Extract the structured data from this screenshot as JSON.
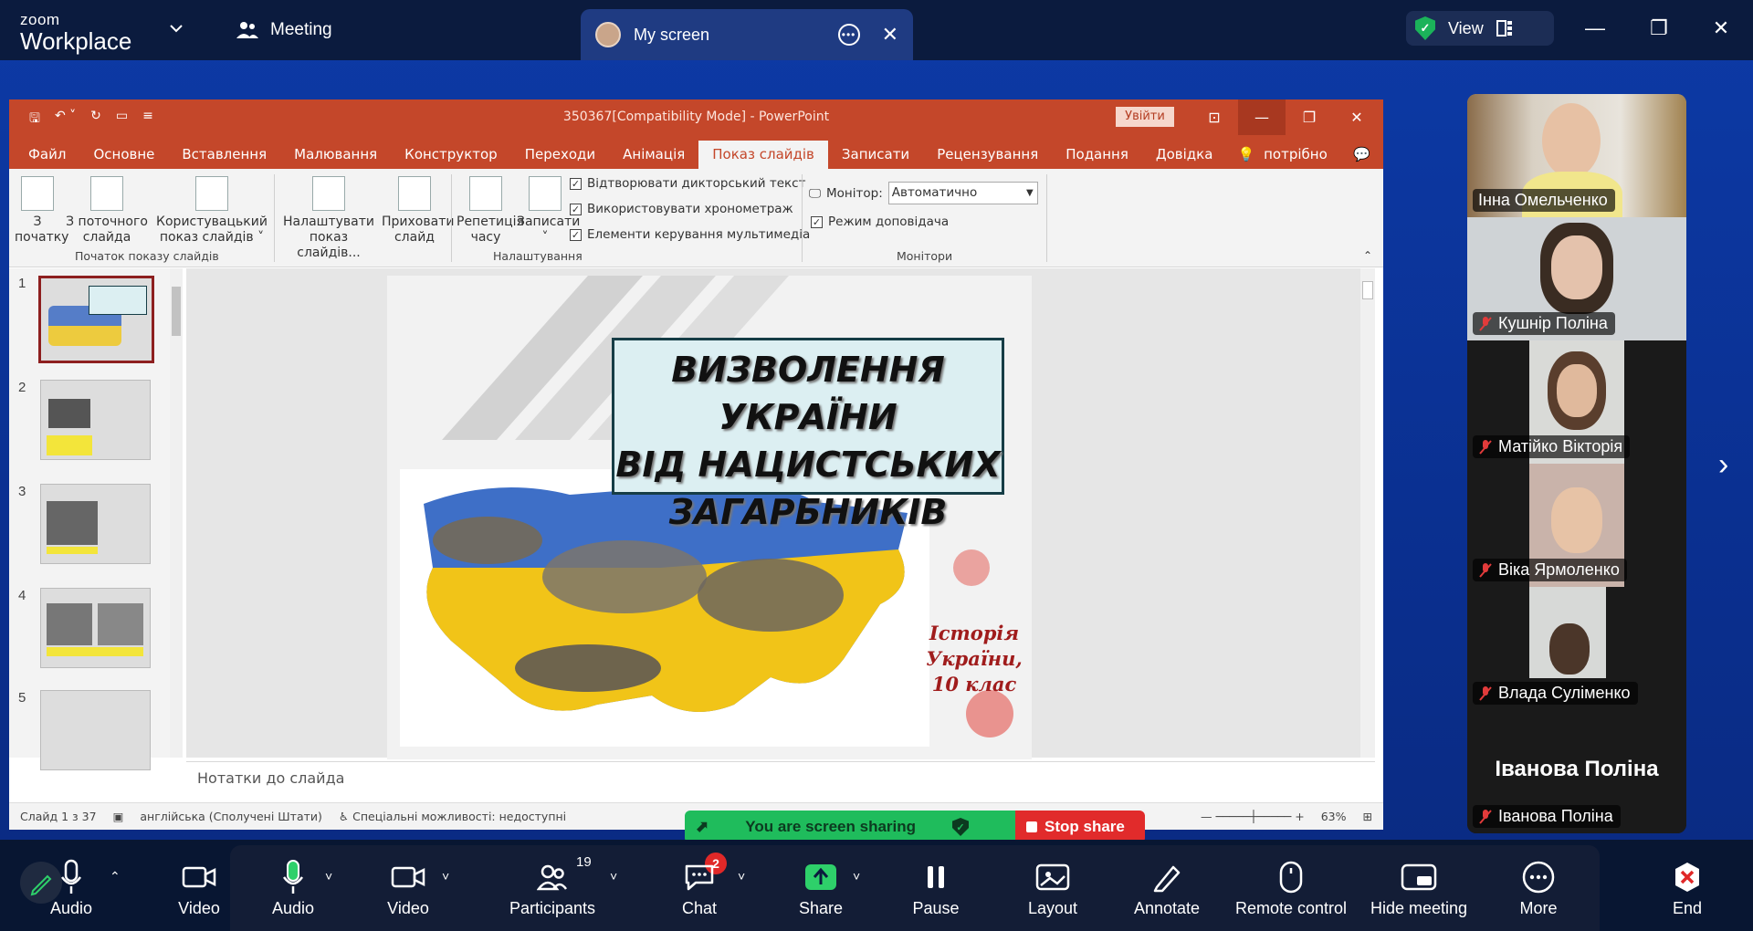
{
  "zoom": {
    "logo_top": "zoom",
    "logo_bottom": "Workplace",
    "meeting_tab": "Meeting",
    "share_tab": "My screen",
    "view_label": "View"
  },
  "ppt": {
    "title": "350367[Compatibility Mode]  -  PowerPoint",
    "signin": "Увійти",
    "tabs": [
      "Файл",
      "Основне",
      "Вставлення",
      "Малювання",
      "Конструктор",
      "Переходи",
      "Анімація",
      "Показ слайдів",
      "Записати",
      "Рецензування",
      "Подання",
      "Довідка"
    ],
    "tell_me": "Скажіть, що потрібно зробити",
    "ribbon": {
      "from_start": [
        "З",
        "початку"
      ],
      "from_current": [
        "З поточного",
        "слайда"
      ],
      "custom": [
        "Користувацький",
        "показ слайдів ˅"
      ],
      "group1": "Початок показу слайдів",
      "setup": [
        "Налаштувати",
        "показ слайдів..."
      ],
      "hide": [
        "Приховати",
        "слайд"
      ],
      "rehearse": [
        "Репетиція",
        "часу"
      ],
      "record": [
        "Записати",
        "˅"
      ],
      "chk1": "Відтворювати дикторський текст",
      "chk2": "Використовувати хронометраж",
      "chk3": "Елементи керування мультимедіа",
      "group2": "Налаштування",
      "monitor_label": "Монітор:",
      "monitor_value": "Автоматично",
      "presenter": "Режим доповідача",
      "group3": "Монітори"
    },
    "slide_numbers": [
      "1",
      "2",
      "3",
      "4",
      "5"
    ],
    "slide": {
      "title_lines": [
        "ВИЗВОЛЕННЯ УКРАЇНИ",
        "ВІД НАЦИСТСЬКИХ",
        "ЗАГАРБНИКІВ"
      ],
      "subtitle_lines": [
        "Історія",
        "України,",
        "10 клас"
      ]
    },
    "notes": "Нотатки до слайда",
    "status": {
      "slide": "Слайд 1 з 37",
      "lang": "англійська (Сполучені Штати)",
      "access": "Спеціальні можливості: недоступні",
      "zoom": "63%"
    }
  },
  "share_banner": {
    "text": "You are screen sharing",
    "stop": "Stop share"
  },
  "participants": [
    {
      "name": "Інна Омельченко",
      "muted": false
    },
    {
      "name": "Кушнір Поліна",
      "muted": true
    },
    {
      "name": "Матійко Вікторія",
      "muted": true
    },
    {
      "name": "Віка Ярмоленко",
      "muted": true
    },
    {
      "name": "Влада Суліменко",
      "muted": true
    },
    {
      "name": "Іванова Поліна",
      "muted": true
    }
  ],
  "big_name": "Іванова Поліна",
  "toolbar": {
    "left_audio": "Audio",
    "left_video": "Video",
    "audio": "Audio",
    "video": "Video",
    "participants": "Participants",
    "participants_count": "19",
    "chat": "Chat",
    "chat_badge": "2",
    "share": "Share",
    "pause": "Pause",
    "layout": "Layout",
    "annotate": "Annotate",
    "remote": "Remote control",
    "hide": "Hide meeting",
    "more": "More",
    "end": "End"
  }
}
